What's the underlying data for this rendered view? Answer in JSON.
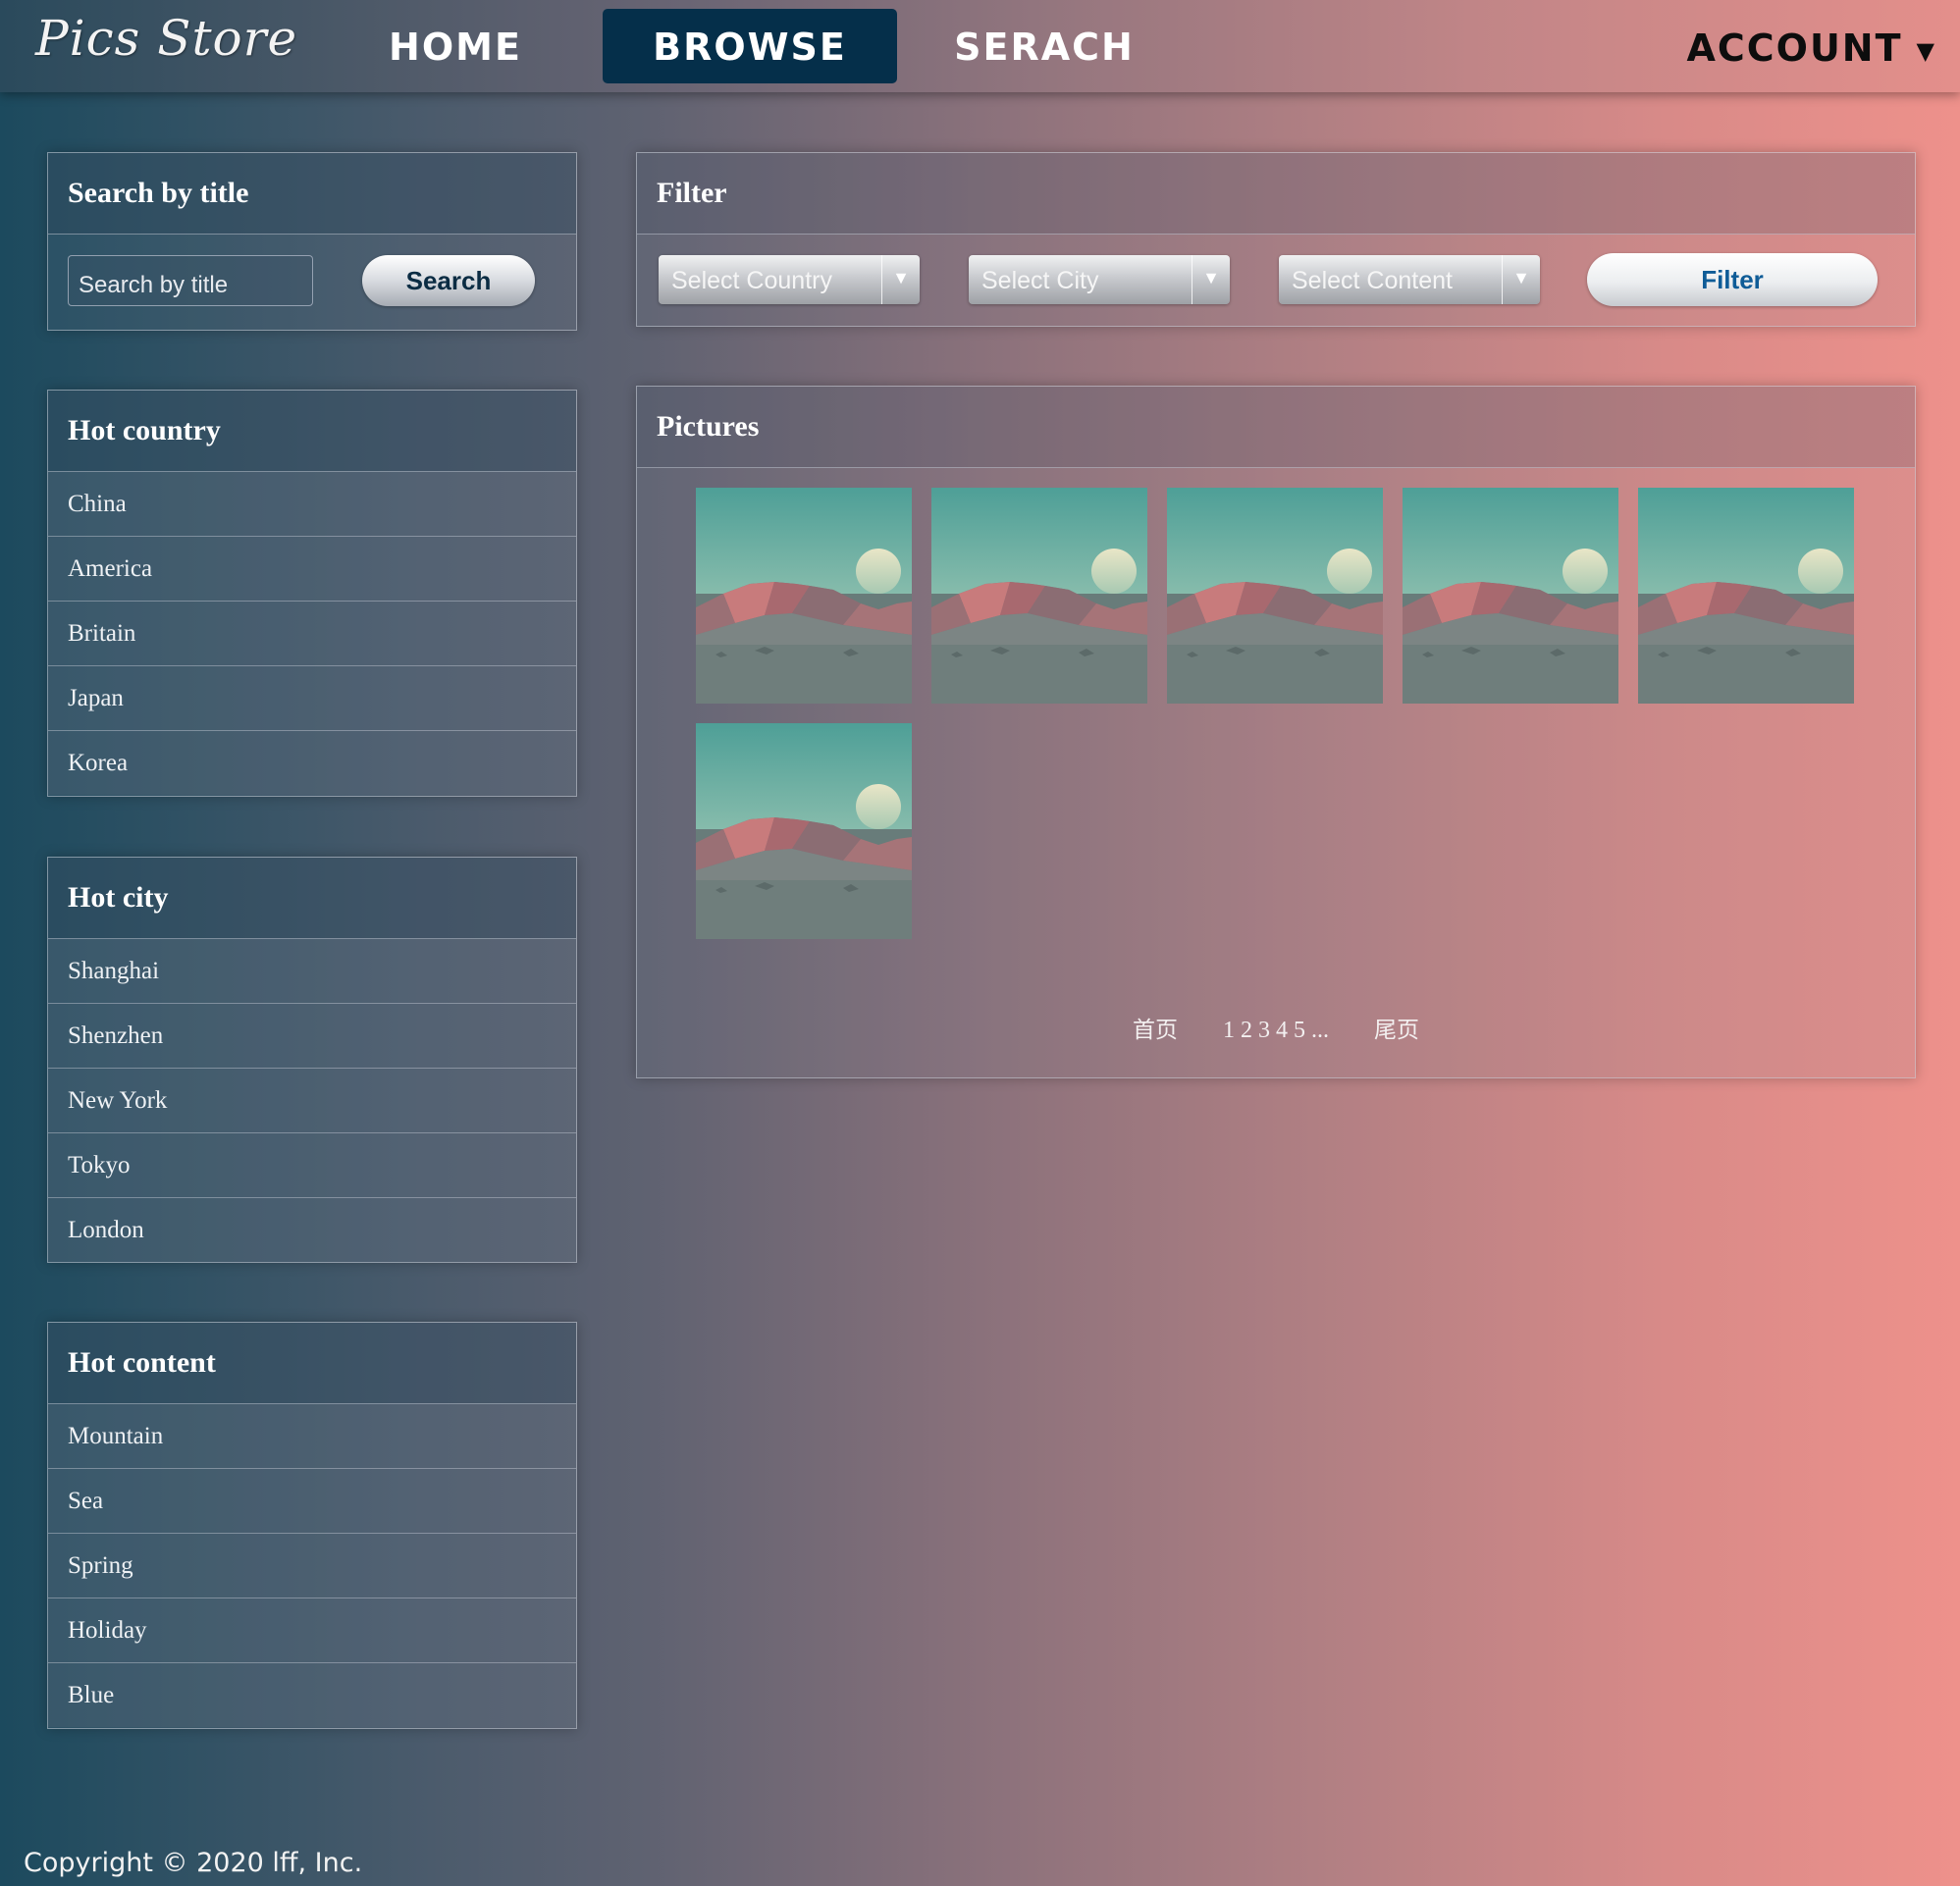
{
  "nav": {
    "logo": "Pics Store",
    "home": "HOME",
    "browse": "BROWSE",
    "search": "SERACH",
    "account": "ACCOUNT",
    "account_caret_icon": "caret-down"
  },
  "search_panel": {
    "title": "Search by title",
    "input_placeholder": "Search by title",
    "button": "Search"
  },
  "hot_country": {
    "title": "Hot country",
    "items": [
      "China",
      "America",
      "Britain",
      "Japan",
      "Korea"
    ]
  },
  "hot_city": {
    "title": "Hot city",
    "items": [
      "Shanghai",
      "Shenzhen",
      "New York",
      "Tokyo",
      "London"
    ]
  },
  "hot_content": {
    "title": "Hot content",
    "items": [
      "Mountain",
      "Sea",
      "Spring",
      "Holiday",
      "Blue"
    ]
  },
  "filter": {
    "title": "Filter",
    "country_placeholder": "Select Country",
    "city_placeholder": "Select City",
    "content_placeholder": "Select Content",
    "button": "Filter"
  },
  "pictures": {
    "title": "Pictures",
    "count": 6,
    "pager": {
      "first": "首页",
      "pages": "1 2 3 4 5 ...",
      "last": "尾页"
    }
  },
  "footer": {
    "copyright": "Copyright © 2020 lff, Inc."
  },
  "colors": {
    "nav_active": "#052f4a",
    "filter_button_text": "#0f5c97",
    "gradient_left": "#1c4a5e",
    "gradient_right": "#ee918b"
  }
}
